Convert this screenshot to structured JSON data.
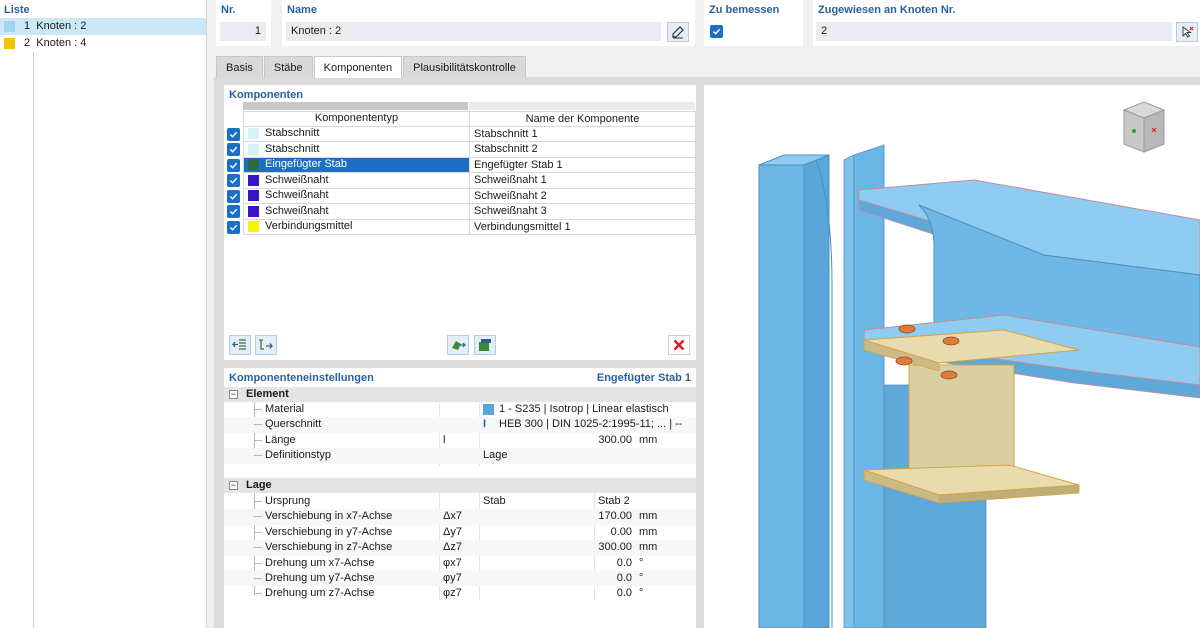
{
  "list_panel": {
    "title": "Liste",
    "items": [
      {
        "num": "1",
        "label": "Knoten : 2",
        "color": "#9fd6ee"
      },
      {
        "num": "2",
        "label": "Knoten : 4",
        "color": "#f2c500"
      }
    ]
  },
  "header": {
    "nr_label": "Nr.",
    "nr_value": "1",
    "name_label": "Name",
    "name_value": "Knoten : 2",
    "zu_bemessen_label": "Zu bemessen",
    "zugewiesen_label": "Zugewiesen an Knoten Nr.",
    "zugewiesen_value": "2"
  },
  "tabs": [
    {
      "label": "Basis"
    },
    {
      "label": "Stäbe"
    },
    {
      "label": "Komponenten"
    },
    {
      "label": "Plausibilitätskontrolle"
    }
  ],
  "components": {
    "title": "Komponenten",
    "col_type": "Komponententyp",
    "col_name": "Name der Komponente",
    "rows": [
      {
        "type": "Stabschnitt",
        "name": "Stabschnitt 1",
        "color": "#d4f3fb"
      },
      {
        "type": "Stabschnitt",
        "name": "Stabschnitt 2",
        "color": "#d4f3fb"
      },
      {
        "type": "Eingefügter Stab",
        "name": "Engefügter Stab 1",
        "color": "#2d6a3c"
      },
      {
        "type": "Schweißnaht",
        "name": "Schweißnaht 1",
        "color": "#3a12c8"
      },
      {
        "type": "Schweißnaht",
        "name": "Schweißnaht 2",
        "color": "#3a12c8"
      },
      {
        "type": "Schweißnaht",
        "name": "Schweißnaht 3",
        "color": "#3a12c8"
      },
      {
        "type": "Verbindungsmittel",
        "name": "Verbindungsmittel 1",
        "color": "#f7f500"
      }
    ]
  },
  "settings": {
    "title": "Komponenteneinstellungen",
    "subtitle": "Engefügter Stab 1",
    "group_element": "Element",
    "group_lage": "Lage",
    "element_rows": [
      {
        "name": "Material",
        "symbol": "",
        "value": "1 - S235 | Isotrop | Linear elastisch",
        "unit": ""
      },
      {
        "name": "Querschnitt",
        "symbol": "",
        "value": "HEB 300 | DIN 1025-2:1995-11; ... | --",
        "unit": ""
      },
      {
        "name": "Länge",
        "symbol": "l",
        "value": "300.00",
        "unit": "mm"
      },
      {
        "name": "Definitionstyp",
        "symbol": "",
        "value": "Lage",
        "unit": ""
      }
    ],
    "lage_rows": [
      {
        "name": "Ursprung",
        "symbol": "",
        "value": "Stab",
        "value2": "Stab 2",
        "unit": ""
      },
      {
        "name": "Verschiebung in x7-Achse",
        "symbol": "Δx7",
        "value": "170.00",
        "unit": "mm"
      },
      {
        "name": "Verschiebung in y7-Achse",
        "symbol": "Δy7",
        "value": "0.00",
        "unit": "mm"
      },
      {
        "name": "Verschiebung in z7-Achse",
        "symbol": "Δz7",
        "value": "300.00",
        "unit": "mm"
      },
      {
        "name": "Drehung um x7-Achse",
        "symbol": "φx7",
        "value": "0.0",
        "unit": "°"
      },
      {
        "name": "Drehung um y7-Achse",
        "symbol": "φy7",
        "value": "0.0",
        "unit": "°"
      },
      {
        "name": "Drehung um z7-Achse",
        "symbol": "φz7",
        "value": "0.0",
        "unit": "°"
      }
    ]
  },
  "colors": {
    "accent": "#2a5f9e",
    "selection": "#1d6fc3",
    "steel_blue": "#6cb6e6",
    "inserted_member": "#d9cfa3"
  }
}
